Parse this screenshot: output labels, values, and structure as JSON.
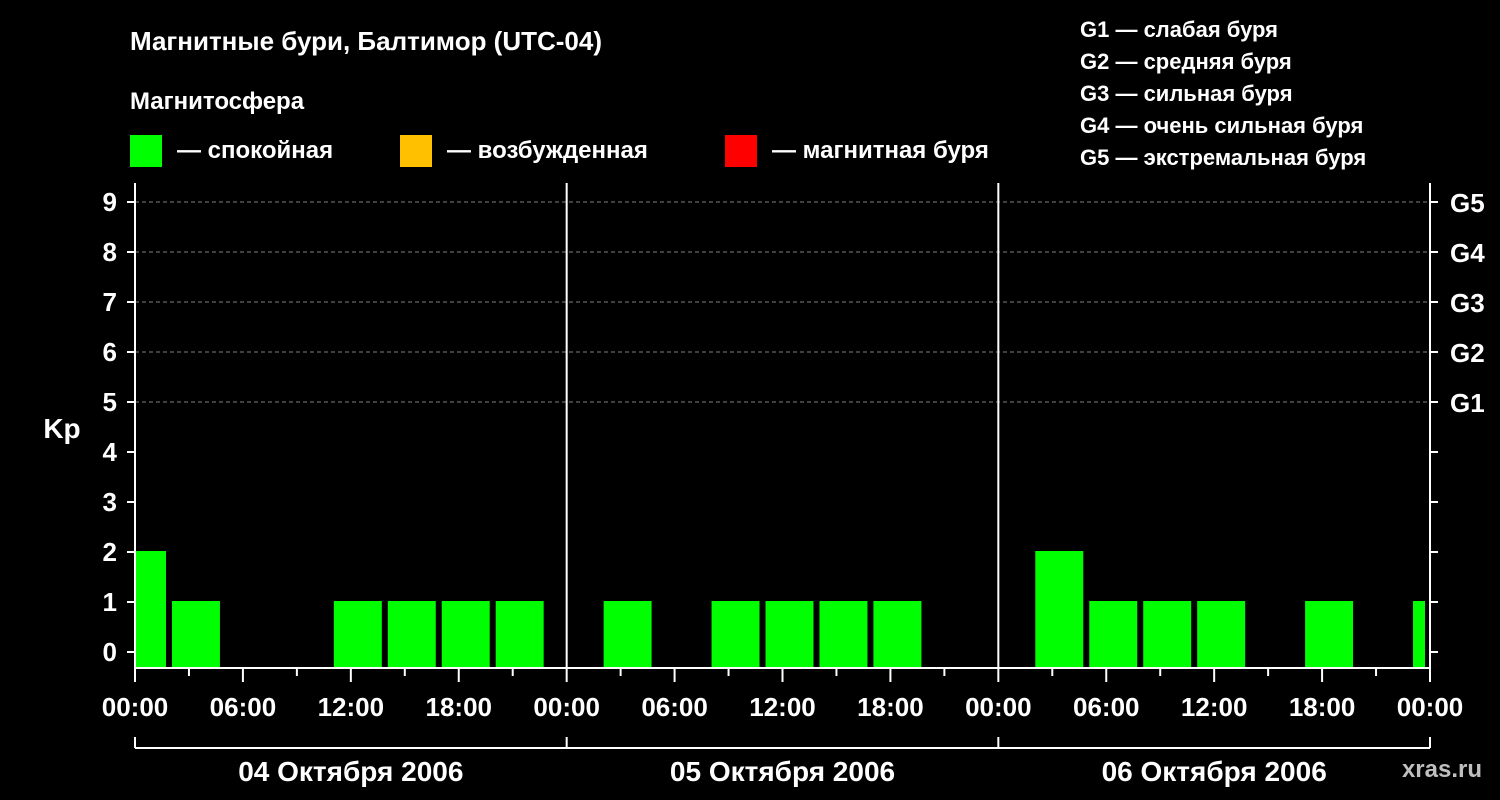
{
  "title": "Магнитные бури, Балтимор (UTC-04)",
  "magnetosphere_heading": "Магнитосфера",
  "legend": [
    {
      "label": "— спокойная",
      "color": "#00ff00"
    },
    {
      "label": "— возбужденная",
      "color": "#ffc000"
    },
    {
      "label": "— магнитная буря",
      "color": "#ff0000"
    }
  ],
  "storm_scale": [
    "G1 — слабая буря",
    "G2 — средняя буря",
    "G3 — сильная буря",
    "G4 — очень сильная буря",
    "G5 — экстремальная буря"
  ],
  "watermark": "xras.ru",
  "colors": {
    "background": "#000000",
    "axis": "#ffffff",
    "grid": "#808080"
  },
  "chart_data": {
    "type": "bar",
    "ylabel": "Kp",
    "ylim": [
      0,
      9
    ],
    "y_ticks": [
      "0",
      "1",
      "2",
      "3",
      "4",
      "5",
      "6",
      "7",
      "8",
      "9"
    ],
    "right_ticks": [
      {
        "y": 5,
        "label": "G1"
      },
      {
        "y": 6,
        "label": "G2"
      },
      {
        "y": 7,
        "label": "G3"
      },
      {
        "y": 8,
        "label": "G4"
      },
      {
        "y": 9,
        "label": "G5"
      }
    ],
    "grid_dashed": [
      5,
      6,
      7,
      8,
      9
    ],
    "x_range_hours": [
      0,
      72
    ],
    "x_tick_labels": [
      "00:00",
      "06:00",
      "12:00",
      "18:00",
      "00:00",
      "06:00",
      "12:00",
      "18:00",
      "00:00",
      "06:00",
      "12:00",
      "18:00",
      "00:00"
    ],
    "days": [
      "04 Октября 2006",
      "05 Октября 2006",
      "06 Октября 2006"
    ],
    "bars": [
      {
        "start": 0,
        "end": 2,
        "kp": 2,
        "state": "quiet"
      },
      {
        "start": 2,
        "end": 5,
        "kp": 1,
        "state": "quiet"
      },
      {
        "start": 5,
        "end": 8,
        "kp": 0,
        "state": "quiet"
      },
      {
        "start": 8,
        "end": 11,
        "kp": 0,
        "state": "quiet"
      },
      {
        "start": 11,
        "end": 14,
        "kp": 1,
        "state": "quiet"
      },
      {
        "start": 14,
        "end": 17,
        "kp": 1,
        "state": "quiet"
      },
      {
        "start": 17,
        "end": 20,
        "kp": 1,
        "state": "quiet"
      },
      {
        "start": 20,
        "end": 23,
        "kp": 1,
        "state": "quiet"
      },
      {
        "start": 23,
        "end": 26,
        "kp": 0,
        "state": "quiet"
      },
      {
        "start": 26,
        "end": 29,
        "kp": 1,
        "state": "quiet"
      },
      {
        "start": 29,
        "end": 32,
        "kp": 0,
        "state": "quiet"
      },
      {
        "start": 32,
        "end": 35,
        "kp": 1,
        "state": "quiet"
      },
      {
        "start": 35,
        "end": 38,
        "kp": 1,
        "state": "quiet"
      },
      {
        "start": 38,
        "end": 41,
        "kp": 1,
        "state": "quiet"
      },
      {
        "start": 41,
        "end": 44,
        "kp": 1,
        "state": "quiet"
      },
      {
        "start": 44,
        "end": 47,
        "kp": 0,
        "state": "quiet"
      },
      {
        "start": 47,
        "end": 50,
        "kp": 0,
        "state": "quiet"
      },
      {
        "start": 50,
        "end": 53,
        "kp": 2,
        "state": "quiet"
      },
      {
        "start": 53,
        "end": 56,
        "kp": 1,
        "state": "quiet"
      },
      {
        "start": 56,
        "end": 59,
        "kp": 1,
        "state": "quiet"
      },
      {
        "start": 59,
        "end": 62,
        "kp": 1,
        "state": "quiet"
      },
      {
        "start": 62,
        "end": 65,
        "kp": 0,
        "state": "quiet"
      },
      {
        "start": 65,
        "end": 68,
        "kp": 1,
        "state": "quiet"
      },
      {
        "start": 68,
        "end": 71,
        "kp": 0,
        "state": "quiet"
      },
      {
        "start": 71,
        "end": 72,
        "kp": 1,
        "state": "quiet"
      }
    ],
    "state_colors": {
      "quiet": "#00ff00",
      "active": "#ffc000",
      "storm": "#ff0000"
    }
  }
}
